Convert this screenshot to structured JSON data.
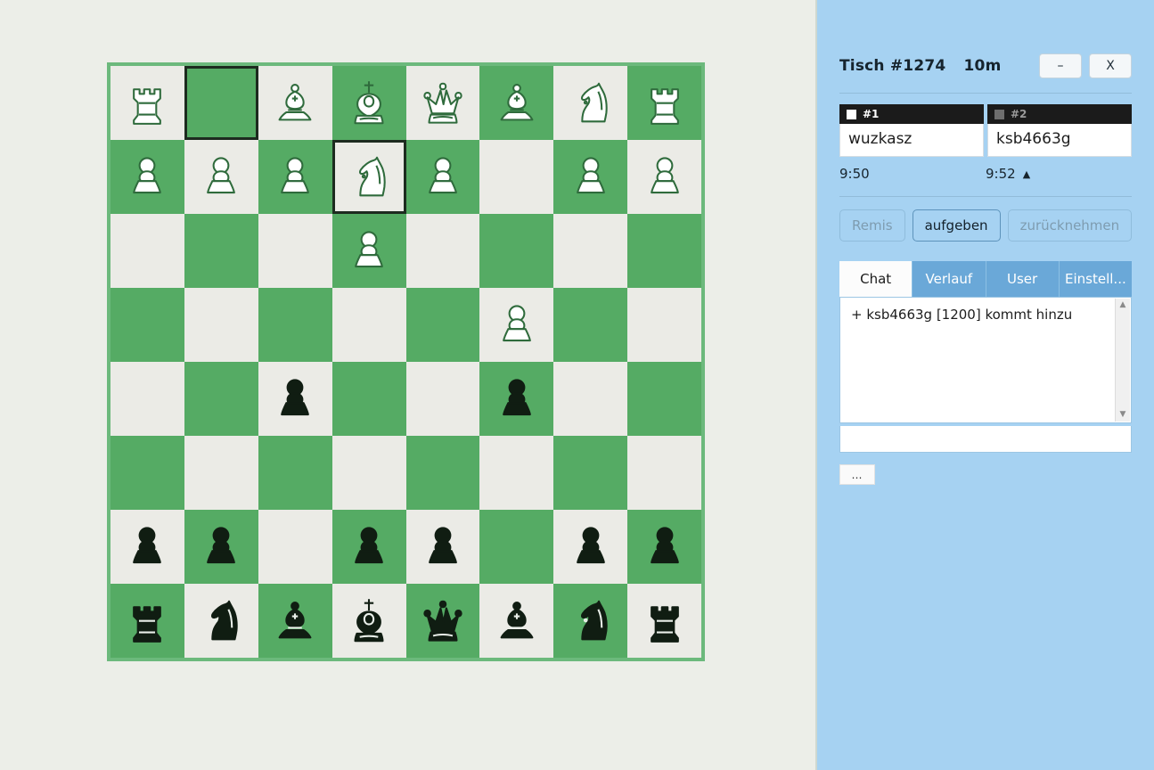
{
  "window": {
    "title": "Tisch #1274",
    "duration": "10m",
    "minimize_label": "–",
    "close_label": "X"
  },
  "players": [
    {
      "slot": "#1",
      "name": "wuzkasz",
      "color": "white",
      "clock": "9:50",
      "active": false
    },
    {
      "slot": "#2",
      "name": "ksb4663g",
      "color": "black",
      "clock": "9:52",
      "active": true
    }
  ],
  "turn_indicator": "▲",
  "actions": [
    {
      "label": "Remis",
      "enabled": false
    },
    {
      "label": "aufgeben",
      "enabled": true
    },
    {
      "label": "zurücknehmen",
      "enabled": false
    }
  ],
  "tabs": [
    {
      "label": "Chat",
      "active": true
    },
    {
      "label": "Verlauf",
      "active": false
    },
    {
      "label": "User",
      "active": false
    },
    {
      "label": "Einstell...",
      "active": false
    }
  ],
  "chat": {
    "messages": [
      "+ ksb4663g [1200] kommt hinzu"
    ],
    "input_value": "",
    "input_placeholder": "",
    "scroll_up_icon": "▲",
    "scroll_down_icon": "▼"
  },
  "more_button_label": "…",
  "colors": {
    "panel_bg": "#a6d2f2",
    "board_light": "#ebebe6",
    "board_dark": "#55ab64",
    "board_border": "#6cb97c",
    "page_bg": "#eceee8",
    "tab_inactive": "#6aa8d8",
    "highlight_border": "#1d2b1f"
  },
  "board": {
    "orientation": "white-top",
    "rows": [
      [
        "wR",
        "",
        "wB",
        "wK",
        "wQ",
        "wB",
        "wN",
        "wR"
      ],
      [
        "wP",
        "wP",
        "wP",
        "wN",
        "wP",
        "",
        "wP",
        "wP"
      ],
      [
        "",
        "",
        "",
        "wP",
        "",
        "",
        "",
        ""
      ],
      [
        "",
        "",
        "",
        "",
        "",
        "wP",
        "",
        ""
      ],
      [
        "",
        "",
        "bP",
        "",
        "",
        "bP",
        "",
        ""
      ],
      [
        "",
        "",
        "",
        "",
        "",
        "",
        "",
        ""
      ],
      [
        "bP",
        "bP",
        "",
        "bP",
        "bP",
        "",
        "bP",
        "bP"
      ],
      [
        "bR",
        "bN",
        "bB",
        "bK",
        "bQ",
        "bB",
        "bN",
        "bR"
      ]
    ],
    "highlighted": [
      [
        0,
        1
      ],
      [
        1,
        3
      ]
    ]
  }
}
